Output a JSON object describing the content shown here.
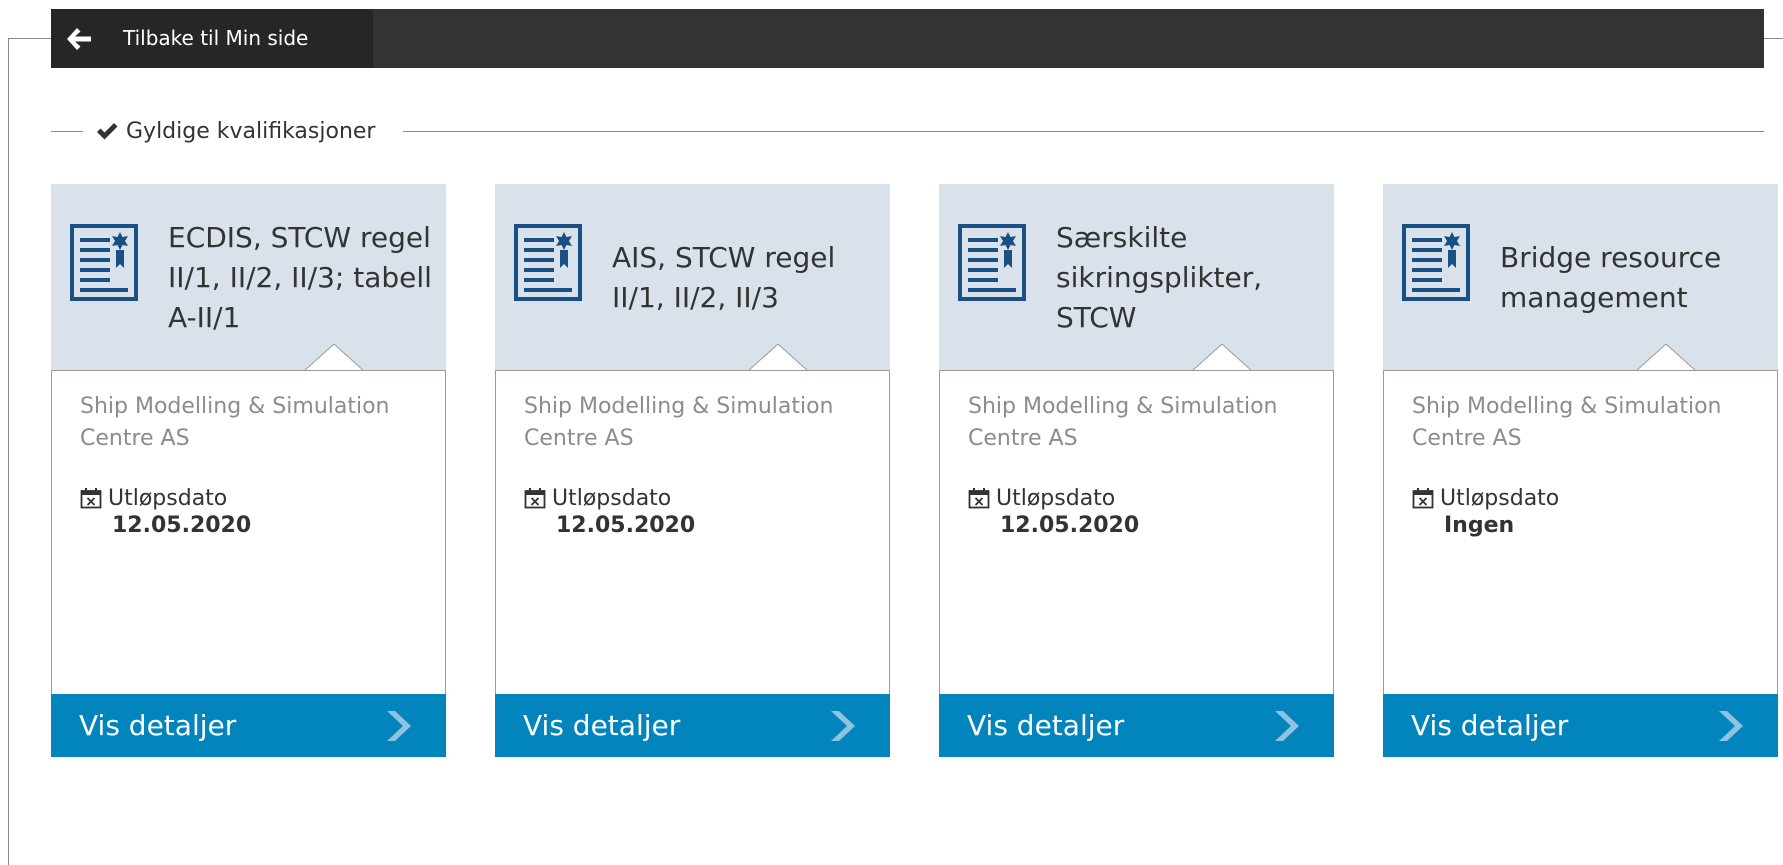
{
  "header": {
    "back_label": "Tilbake til Min side",
    "back_icon": "arrow-left-icon"
  },
  "section": {
    "title": "Gyldige kvalifikasjoner",
    "icon": "checkmark-icon"
  },
  "colors": {
    "topbar": "#333333",
    "back_button": "#262626",
    "card_header": "#d9e2eb",
    "card_footer": "#0284bd",
    "icon_blue": "#1a4f84",
    "provider_text": "#8c8c8c"
  },
  "cards": [
    {
      "title": "ECDIS, STCW regel II/1, II/2, II/3; tabell A-II/1",
      "provider": "Ship Modelling & Simulation Centre AS",
      "expiry_label": "Utløpsdato",
      "expiry_value": "12.05.2020",
      "details_label": "Vis detaljer"
    },
    {
      "title": "AIS, STCW regel II/1, II/2, II/3",
      "provider": "Ship Modelling & Simulation Centre AS",
      "expiry_label": "Utløpsdato",
      "expiry_value": "12.05.2020",
      "details_label": "Vis detaljer"
    },
    {
      "title": "Særskilte sikringsplikter, STCW",
      "provider": "Ship Modelling & Simulation Centre AS",
      "expiry_label": "Utløpsdato",
      "expiry_value": "12.05.2020",
      "details_label": "Vis detaljer"
    },
    {
      "title": "Bridge resource management",
      "provider": "Ship Modelling & Simulation Centre AS",
      "expiry_label": "Utløpsdato",
      "expiry_value": "Ingen",
      "details_label": "Vis detaljer"
    }
  ]
}
